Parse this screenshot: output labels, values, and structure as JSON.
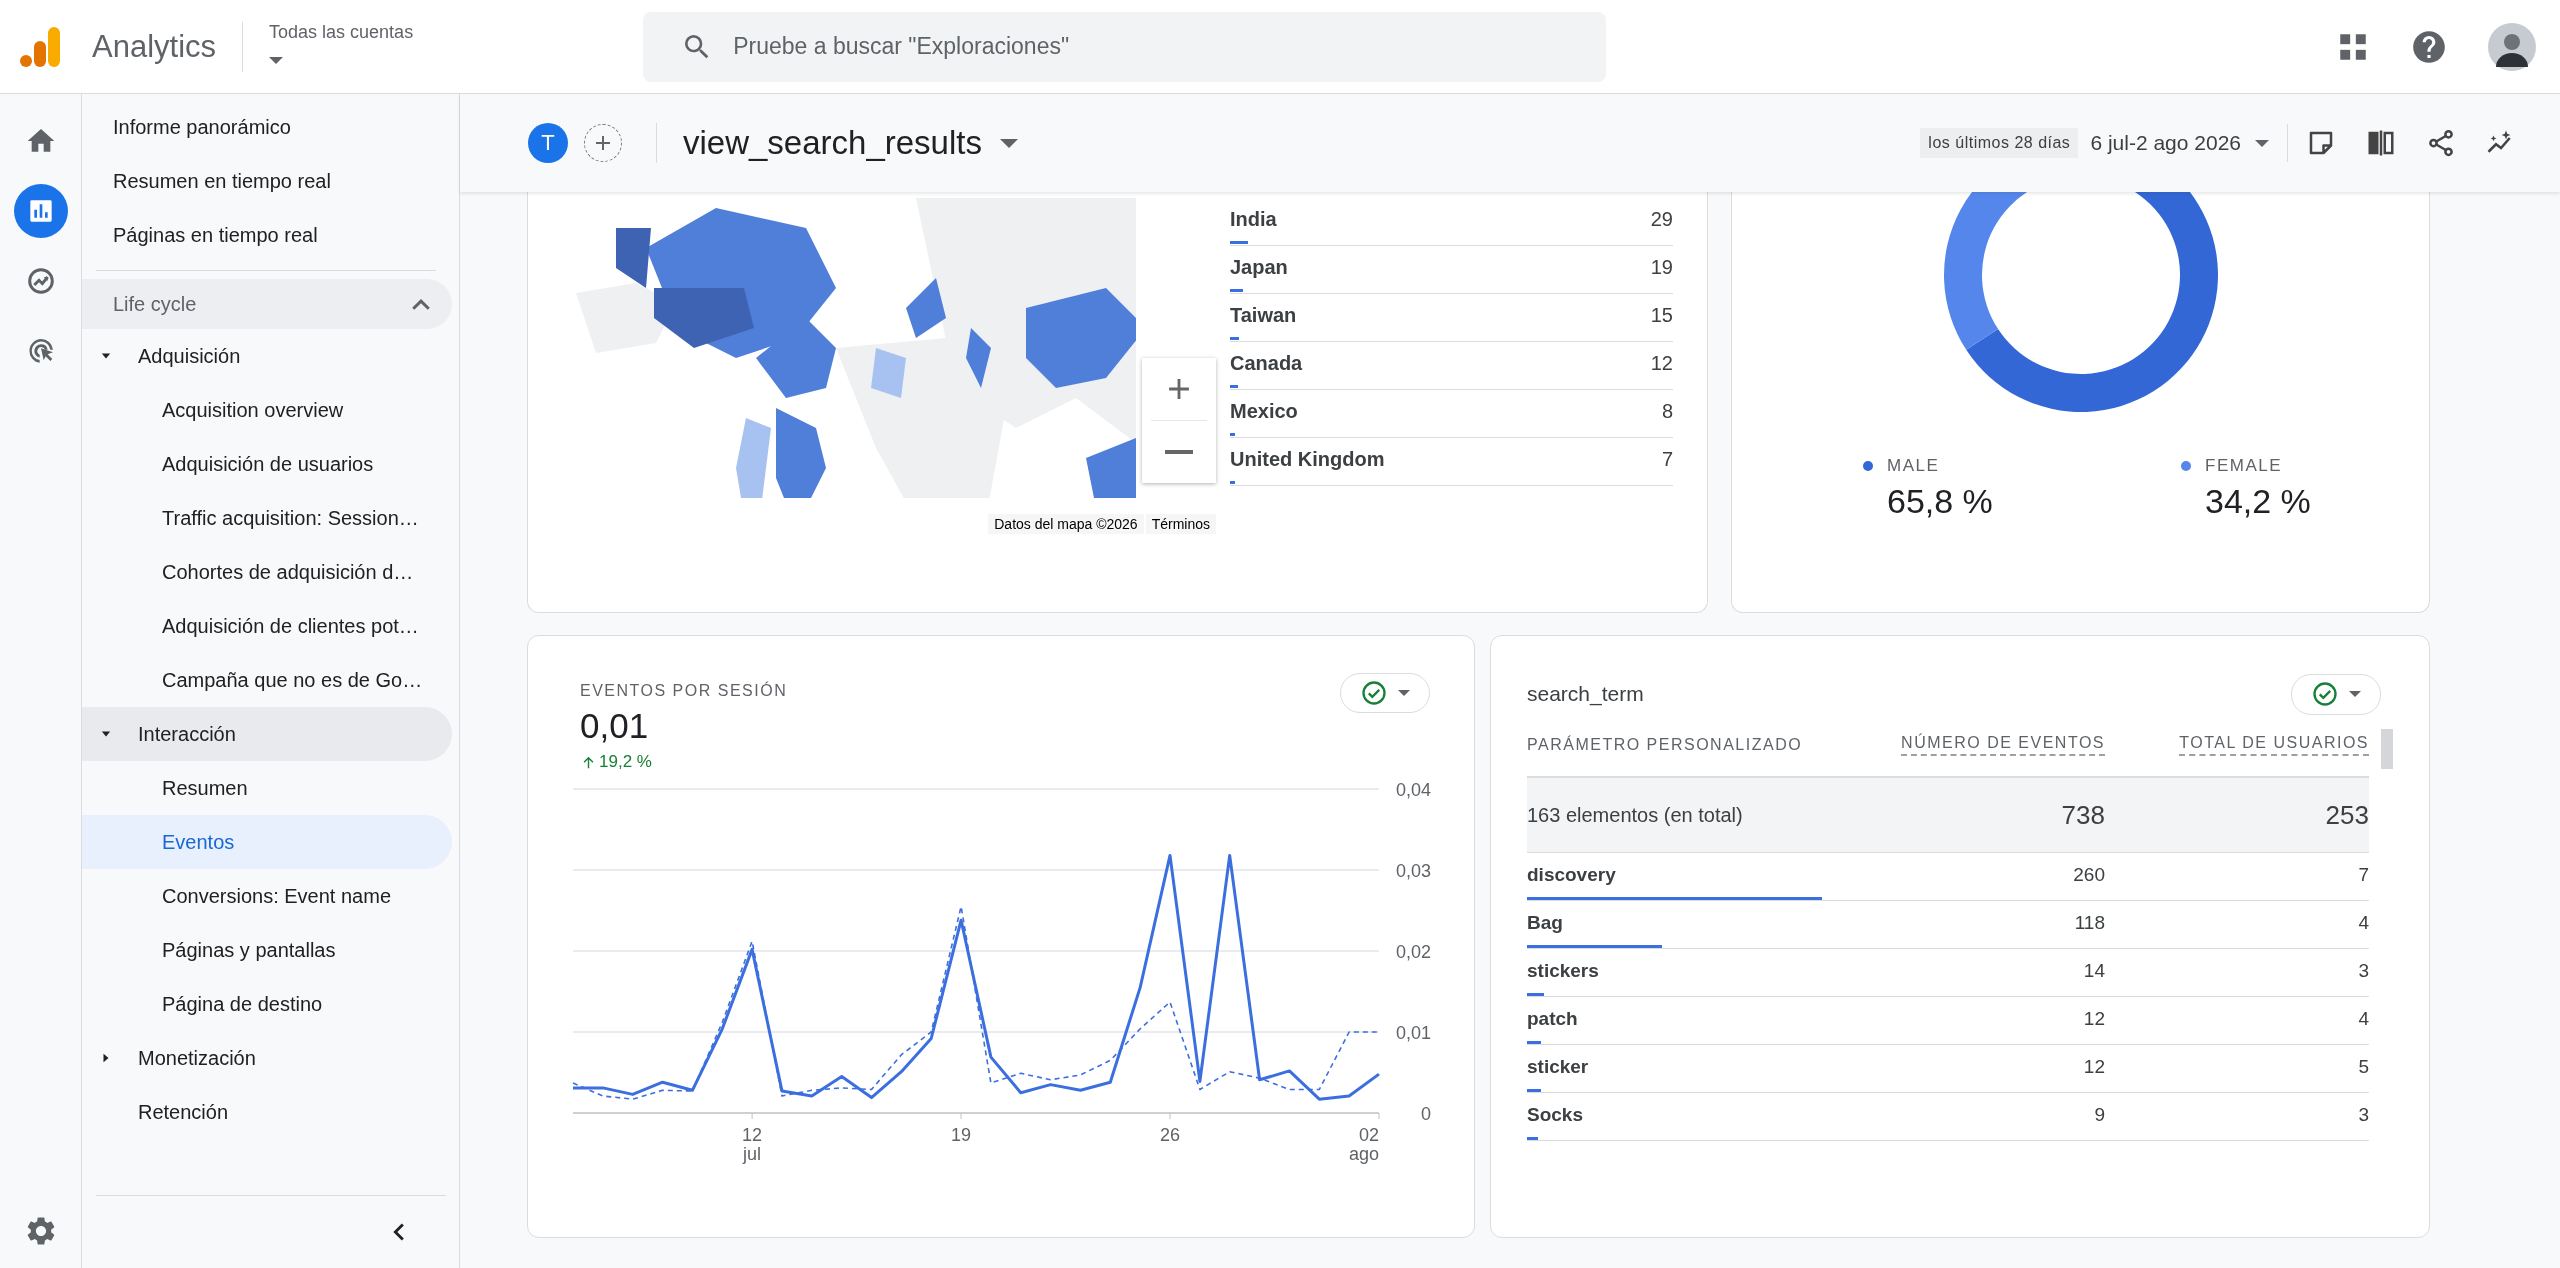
{
  "topbar": {
    "product": "Analytics",
    "account": "Todas las cuentas",
    "search": {
      "placeholder": "Pruebe a buscar \"Exploraciones\""
    }
  },
  "rail": [
    {
      "kind": "home",
      "selected": false
    },
    {
      "kind": "reports",
      "selected": true
    },
    {
      "kind": "explore",
      "selected": false
    },
    {
      "kind": "advertising",
      "selected": false
    }
  ],
  "sidebar": {
    "items": [
      {
        "label": "Informe panorámico",
        "selected": false
      },
      {
        "label": "Resumen en tiempo real",
        "selected": false
      },
      {
        "label": "Páginas en tiempo real",
        "selected": false
      }
    ],
    "sections": [
      {
        "label": "Life cycle",
        "expanded": true,
        "items": [
          {
            "label": "Adquisición",
            "expanded": true,
            "selected": false,
            "children": [
              {
                "label": "Acquisition overview",
                "selected": false
              },
              {
                "label": "Adquisición de usuarios",
                "selected": false
              },
              {
                "label": "Traffic acquisition: Session…",
                "selected": false
              },
              {
                "label": "Cohortes de adquisición d…",
                "selected": false
              },
              {
                "label": "Adquisición de clientes pot…",
                "selected": false
              },
              {
                "label": "Campaña que no es de Go…",
                "selected": false
              }
            ]
          },
          {
            "label": "Interacción",
            "expanded": true,
            "selected": false,
            "children": [
              {
                "label": "Resumen",
                "selected": false
              },
              {
                "label": "Eventos",
                "selected": true
              },
              {
                "label": "Conversions: Event name",
                "selected": false
              },
              {
                "label": "Páginas y pantallas",
                "selected": false
              },
              {
                "label": "Página de destino",
                "selected": false
              }
            ]
          },
          {
            "label": "Monetización",
            "expanded": false,
            "selected": false
          },
          {
            "label": "Retención",
            "selected": false
          }
        ]
      }
    ]
  },
  "report": {
    "avatar": "T",
    "title": "view_search_results",
    "date_preset": "los últimos 28 días",
    "date_range": "6 jul-2 ago 2026"
  },
  "map_card": {
    "countries": [
      {
        "name": "India",
        "value": "29",
        "level": 0.04
      },
      {
        "name": "Japan",
        "value": "19",
        "level": 0.03
      },
      {
        "name": "Taiwan",
        "value": "15",
        "level": 0.02
      },
      {
        "name": "Canada",
        "value": "12",
        "level": 0.018
      },
      {
        "name": "Mexico",
        "value": "8",
        "level": 0.012
      },
      {
        "name": "United Kingdom",
        "value": "7",
        "level": 0.012
      }
    ],
    "attribution": "Datos del mapa ©2026",
    "terms": "Términos"
  },
  "gender_card": {
    "chart_data": {
      "type": "donut",
      "values": [
        65.8,
        34.2
      ]
    },
    "legend": [
      {
        "label": "MALE",
        "value": "65,8 %",
        "color": "#3367d6"
      },
      {
        "label": "FEMALE",
        "value": "34,2 %",
        "color": "#5586ec"
      }
    ]
  },
  "line_card": {
    "title": "EVENTOS POR SESIÓN",
    "value": "0,01",
    "change": "19,2 %",
    "months": [
      "jul",
      "ago"
    ],
    "axis_end_label": "02",
    "chart_data": {
      "type": "line",
      "grid": true,
      "xlim": [
        6,
        33
      ],
      "x": [
        6,
        7,
        8,
        9,
        10,
        11,
        12,
        13,
        14,
        15,
        16,
        17,
        18,
        19,
        20,
        21,
        22,
        23,
        24,
        25,
        26,
        27,
        28,
        29,
        30,
        31,
        32,
        33
      ],
      "xticks": [
        12,
        19,
        26
      ],
      "ylim": [
        0,
        0.04
      ],
      "yticks": [
        {
          "value": 0,
          "label": "0"
        },
        {
          "value": 0.01,
          "label": "0,01"
        },
        {
          "value": 0.02,
          "label": "0,02"
        },
        {
          "value": 0.03,
          "label": "0,03"
        },
        {
          "value": 0.04,
          "label": "0,04"
        }
      ],
      "series": [
        {
          "color": "#3b6fe0",
          "line_style": "solid",
          "values": [
            0.0031,
            0.0031,
            0.0023,
            0.0038,
            0.0028,
            0.0104,
            0.0202,
            0.0027,
            0.0021,
            0.0045,
            0.0019,
            0.0051,
            0.0092,
            0.0238,
            0.0069,
            0.0025,
            0.0035,
            0.0028,
            0.0038,
            0.0155,
            0.0318,
            0.0039,
            0.0318,
            0.0041,
            0.0052,
            0.0017,
            0.0021,
            0.0048
          ]
        },
        {
          "color": "#3b6fe0",
          "line_style": "dashed",
          "values": [
            0.0037,
            0.0021,
            0.0017,
            0.0028,
            0.0027,
            0.0112,
            0.0212,
            0.0021,
            0.0028,
            0.0031,
            0.0029,
            0.0072,
            0.01,
            0.0255,
            0.0037,
            0.0049,
            0.0041,
            0.0047,
            0.0065,
            0.0104,
            0.0137,
            0.0029,
            0.0051,
            0.0043,
            0.0029,
            0.0029,
            0.01,
            0.01
          ]
        }
      ]
    }
  },
  "table_card": {
    "title": "search_term",
    "columns": [
      {
        "label": "PARÁMETRO PERSONALIZADO",
        "kind": "dimension"
      },
      {
        "label": "NÚMERO DE EVENTOS",
        "kind": "metric"
      },
      {
        "label": "TOTAL DE USUARIOS",
        "kind": "metric"
      }
    ],
    "total": {
      "label": "163 elementos (en total)",
      "values": [
        "738",
        "253"
      ]
    },
    "rows": [
      {
        "term": "discovery",
        "events": "260",
        "users": "7",
        "level": 0.35
      },
      {
        "term": "Bag",
        "events": "118",
        "users": "4",
        "level": 0.16
      },
      {
        "term": "stickers",
        "events": "14",
        "users": "3",
        "level": 0.02
      },
      {
        "term": "patch",
        "events": "12",
        "users": "4",
        "level": 0.017
      },
      {
        "term": "sticker",
        "events": "12",
        "users": "5",
        "level": 0.017
      },
      {
        "term": "Socks",
        "events": "9",
        "users": "3",
        "level": 0.013
      }
    ]
  }
}
